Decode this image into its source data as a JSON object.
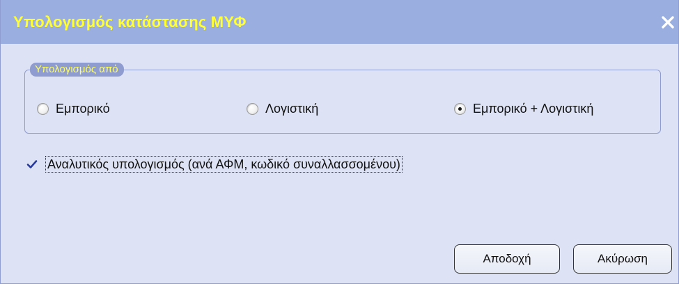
{
  "window": {
    "title": "Υπολογισμός κατάστασης ΜΥΦ",
    "close_icon": "close-icon"
  },
  "calculation_group": {
    "legend": "Υπολογισμός από",
    "options": [
      {
        "label": "Εμπορικό",
        "checked": false
      },
      {
        "label": "Λογιστική",
        "checked": false
      },
      {
        "label": "Εμπορικό + Λογιστική",
        "checked": true
      }
    ]
  },
  "detailed_checkbox": {
    "label": "Αναλυτικός υπολογισμός (ανά ΑΦΜ, κωδικό συναλλασσομένου)",
    "checked": true
  },
  "buttons": {
    "ok_label": "Αποδοχή",
    "cancel_label": "Ακύρωση"
  },
  "colors": {
    "title_bar": "#9aaedf",
    "title_text": "#ffff33",
    "dialog_background": "#dde3f4",
    "group_border": "#8f9ccf",
    "legend_text": "#ffff66",
    "check_mark": "#2a3a9a"
  }
}
